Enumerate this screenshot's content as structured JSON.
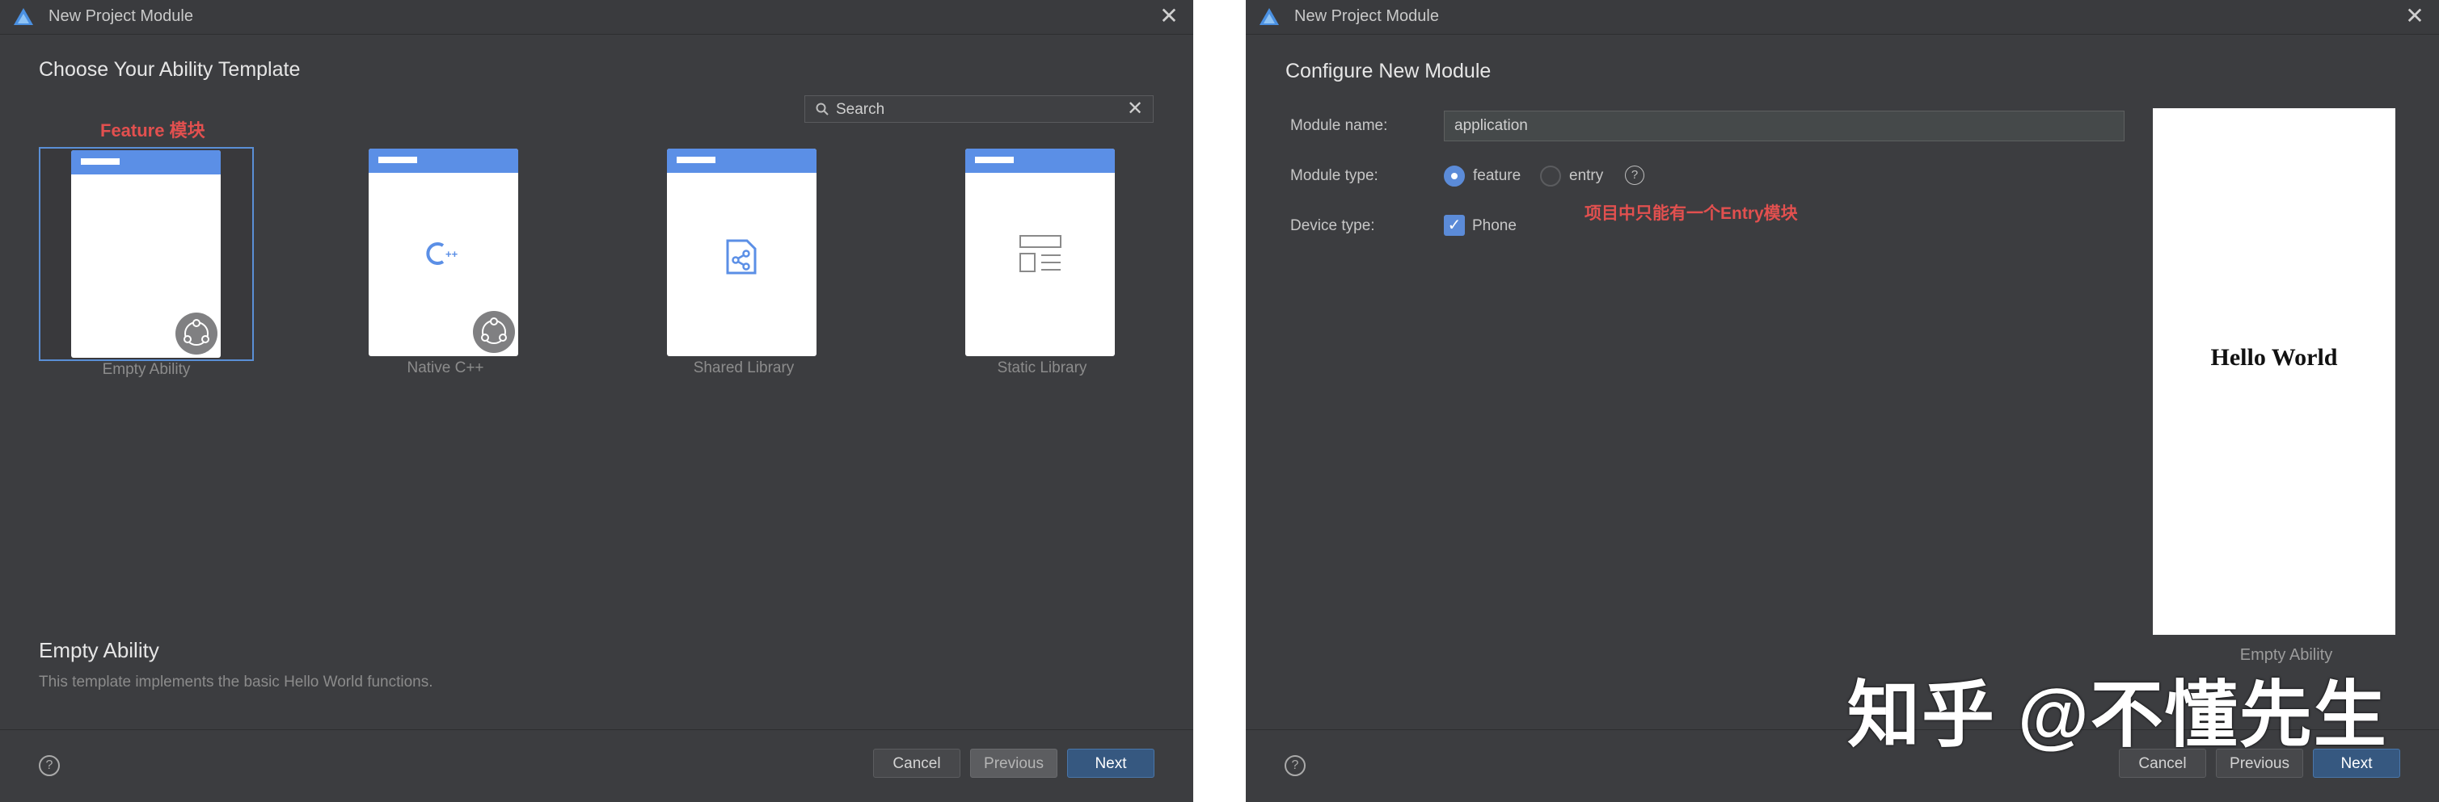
{
  "window1": {
    "title": "New Project Module",
    "heading": "Choose Your Ability Template",
    "annotation": "Feature 模块",
    "search": {
      "placeholder": "Search"
    },
    "templates": [
      {
        "label": "Empty Ability",
        "selected": true
      },
      {
        "label": "Native C++",
        "selected": false
      },
      {
        "label": "Shared Library",
        "selected": false
      },
      {
        "label": "Static Library",
        "selected": false
      }
    ],
    "description": {
      "title": "Empty Ability",
      "text": "This template implements the basic Hello World functions."
    },
    "buttons": {
      "cancel": "Cancel",
      "previous": "Previous",
      "next": "Next"
    }
  },
  "window2": {
    "title": "New Project Module",
    "heading": "Configure New Module",
    "form": {
      "module_name_label": "Module name:",
      "module_name_value": "application",
      "module_type_label": "Module type:",
      "module_type_options": [
        "feature",
        "entry"
      ],
      "module_type_selected": "feature",
      "device_type_label": "Device type:",
      "device_type_option": "Phone",
      "device_type_checked": true
    },
    "annotation": "项目中只能有一个Entry模块",
    "preview": {
      "text": "Hello World",
      "label": "Empty Ability"
    },
    "buttons": {
      "cancel": "Cancel",
      "previous": "Previous",
      "next": "Next"
    }
  },
  "watermark": "知乎 @不懂先生",
  "colors": {
    "dialog_bg": "#3c3d40",
    "accent_blue": "#5b8fe6",
    "primary_button": "#365880",
    "annotation_red": "#e2504f"
  }
}
